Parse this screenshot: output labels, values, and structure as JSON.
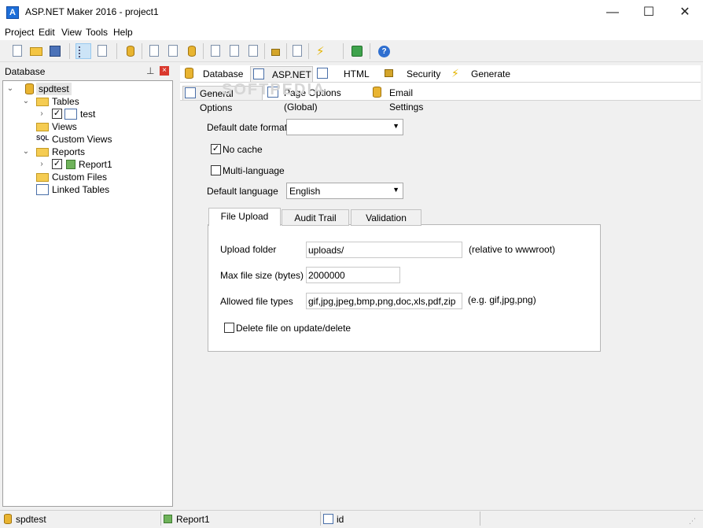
{
  "window": {
    "title": "ASP.NET Maker 2016 - project1",
    "app_icon_letter": "A",
    "minimize": "—",
    "maximize": "☐",
    "close": "✕"
  },
  "menu": [
    {
      "label": "Project"
    },
    {
      "label": "Edit"
    },
    {
      "label": "View"
    },
    {
      "label": "Tools"
    },
    {
      "label": "Help"
    }
  ],
  "database_pane": {
    "title": "Database",
    "pin": "⊥",
    "close": "×"
  },
  "tree": {
    "root": "spdtest",
    "tables": "Tables",
    "table_test": "test",
    "views": "Views",
    "custom_views": "Custom Views",
    "reports": "Reports",
    "report1": "Report1",
    "custom_files": "Custom Files",
    "linked_tables": "Linked Tables",
    "sql_icon_text": "SQL"
  },
  "main_tabs": [
    {
      "label": "Database"
    },
    {
      "label": "ASP.NET"
    },
    {
      "label": "HTML"
    },
    {
      "label": "Security"
    },
    {
      "label": "Generate"
    }
  ],
  "sub_tabs": [
    {
      "label": "General Options"
    },
    {
      "label": "Page Options (Global)"
    },
    {
      "label": "Email Settings"
    }
  ],
  "form": {
    "date_format_label": "Default date format",
    "date_format_value": "",
    "no_cache_label": "No cache",
    "no_cache_checked": "✓",
    "multi_language_label": "Multi-language",
    "default_language_label": "Default language",
    "default_language_value": "English"
  },
  "inner_tabs": [
    {
      "label": "File Upload"
    },
    {
      "label": "Audit Trail"
    },
    {
      "label": "Validation"
    }
  ],
  "upload": {
    "folder_label": "Upload folder",
    "folder_value": "uploads/",
    "folder_hint": "(relative to wwwroot)",
    "max_size_label": "Max file size (bytes)",
    "max_size_value": "2000000",
    "types_label": "Allowed file types",
    "types_value": "gif,jpg,jpeg,bmp,png,doc,xls,pdf,zip",
    "types_hint": "(e.g. gif,jpg,png)",
    "delete_label": "Delete file on update/delete"
  },
  "status": {
    "db": "spdtest",
    "table": "Report1",
    "field": "id"
  },
  "watermark": "SOFTPEDIA"
}
